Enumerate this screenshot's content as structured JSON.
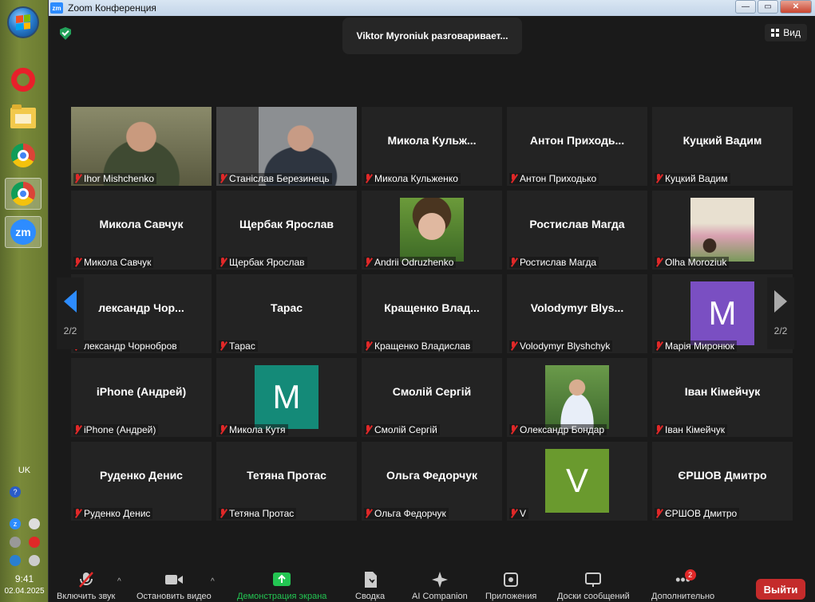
{
  "taskbar": {
    "lang": "UK",
    "time": "9:41",
    "date": "02.04.2025"
  },
  "window": {
    "icon_text": "zm",
    "title": "Zoom Конференция",
    "min": "—",
    "max": "▭",
    "close": "✕"
  },
  "meeting": {
    "speaker_banner": "Viktor Myroniuk разговаривает...",
    "view_label": "Вид",
    "page_left": "2/2",
    "page_right": "2/2"
  },
  "participants": [
    {
      "big": "",
      "label": "Ihor Mishchenko",
      "type": "photo",
      "color": "#6b6a4a"
    },
    {
      "big": "",
      "label": "Станіслав Березинець",
      "type": "photo",
      "color": "#7c7f82"
    },
    {
      "big": "Микола Кульж...",
      "label": "Микола Кульженко",
      "type": "name"
    },
    {
      "big": "Антон Приходь...",
      "label": "Антон Приходько",
      "type": "name"
    },
    {
      "big": "Куцкий Вадим",
      "label": "Куцкий Вадим",
      "type": "name"
    },
    {
      "big": "Микола Савчук",
      "label": "Микола Савчук",
      "type": "name"
    },
    {
      "big": "Щербак Ярослав",
      "label": "Щербак Ярослав",
      "type": "name"
    },
    {
      "big": "",
      "label": "Andrii Odruzhenko",
      "type": "photo",
      "color": "#5f8a3a"
    },
    {
      "big": "Ростислав Магда",
      "label": "Ростислав Магда",
      "type": "name"
    },
    {
      "big": "",
      "label": "Olha Moroziuk",
      "type": "photo",
      "color": "#b9a78a"
    },
    {
      "big": "лександр Чор...",
      "label": "лександр Чорнобров",
      "type": "name"
    },
    {
      "big": "Тарас",
      "label": "Тарас",
      "type": "name"
    },
    {
      "big": "Кращенко Влад...",
      "label": "Кращенко Владислав",
      "type": "name"
    },
    {
      "big": "Volodymyr Blys...",
      "label": "Volodymyr Blyshchyk",
      "type": "name"
    },
    {
      "big": "M",
      "label": "Марія Миронюк",
      "type": "avatar",
      "color": "#7a4fc2"
    },
    {
      "big": "iPhone (Андрей)",
      "label": "iPhone (Андрей)",
      "type": "name"
    },
    {
      "big": "M",
      "label": "Микола Кутя",
      "type": "avatar",
      "color": "#148a78"
    },
    {
      "big": "Смолій Сергій",
      "label": "Смолій Сергій",
      "type": "name"
    },
    {
      "big": "",
      "label": "Олександр Бондар",
      "type": "photo",
      "color": "#5d8a4a"
    },
    {
      "big": "Іван Кімейчук",
      "label": "Іван Кімейчук",
      "type": "name"
    },
    {
      "big": "Руденко Денис",
      "label": "Руденко Денис",
      "type": "name"
    },
    {
      "big": "Тетяна Протас",
      "label": "Тетяна Протас",
      "type": "name"
    },
    {
      "big": "Ольга Федорчук",
      "label": "Ольга Федорчук",
      "type": "name"
    },
    {
      "big": "V",
      "label": "V",
      "type": "avatar",
      "color": "#6a9a2e"
    },
    {
      "big": "ЄРШОВ Дмитро",
      "label": "ЄРШОВ Дмитро",
      "type": "name"
    }
  ],
  "toolbar": {
    "unmute": "Включить звук",
    "stop_video": "Остановить видео",
    "share": "Демонстрация экрана",
    "summary": "Сводка",
    "ai": "AI Companion",
    "apps": "Приложения",
    "whiteboards": "Доски сообщений",
    "more": "Дополнительно",
    "more_badge": "2",
    "leave": "Выйти",
    "caret": "^"
  },
  "colors": {
    "accent": "#2d8cff",
    "share_green": "#23c552",
    "leave_red": "#c42b2b"
  }
}
